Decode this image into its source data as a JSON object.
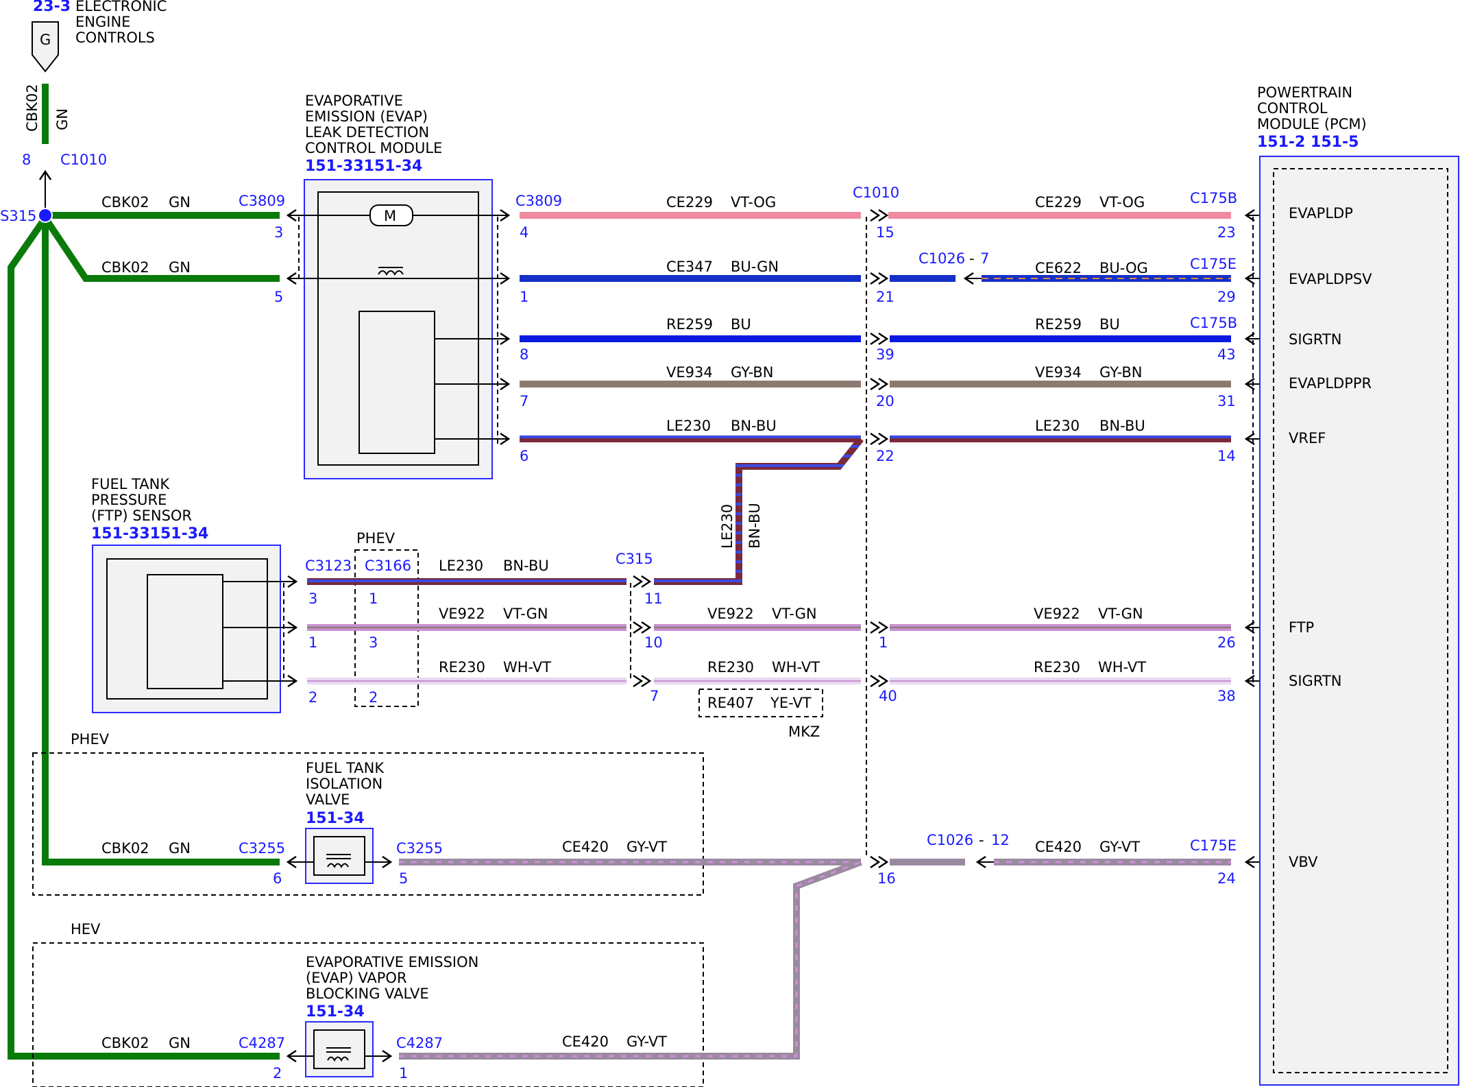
{
  "header": {
    "ref": "23-3",
    "title_lines": [
      "ELECTRONIC",
      "ENGINE",
      "CONTROLS"
    ],
    "connector_letter": "G"
  },
  "colors": {
    "GN": "#0a7a0a",
    "VT-OG": "#f08aa0",
    "BU-GN": "#1530c8",
    "BU-OG": "#1530c8",
    "BU": "#0a1ae0",
    "GY-BN": "#8a7a70",
    "BN-BU": "#7a2a3a",
    "VT-GN": "#c890d0",
    "WH-VT": "#e8d8f0",
    "GY-VT": "#9a8aa0",
    "ink": "#000000",
    "ref_blue": "#1a1aff"
  },
  "components": {
    "leak_module": {
      "lines": [
        "EVAPORATIVE",
        "EMISSION (EVAP)",
        "LEAK DETECTION",
        "CONTROL MODULE"
      ],
      "ref": "151-33151-34"
    },
    "ftp_sensor": {
      "lines": [
        "FUEL TANK",
        "PRESSURE",
        "(FTP) SENSOR"
      ],
      "ref": "151-33151-34"
    },
    "isolation_valve": {
      "lines": [
        "FUEL TANK",
        "ISOLATION",
        "VALVE"
      ],
      "ref": "151-34"
    },
    "blocking_valve": {
      "lines": [
        "EVAPORATIVE EMISSION",
        "(EVAP) VAPOR",
        "BLOCKING VALVE"
      ],
      "ref": "151-34"
    },
    "pcm": {
      "lines": [
        "POWERTRAIN",
        "CONTROL",
        "MODULE (PCM)"
      ],
      "ref": "151-2 151-5",
      "pins": [
        "EVAPLDP",
        "EVAPLDPSV",
        "SIGRTN",
        "EVAPLDPPR",
        "VREF",
        "FTP",
        "SIGRTN",
        "VBV"
      ]
    }
  },
  "splice": "S315",
  "vertical": {
    "circuit": "CBK02",
    "color": "GN",
    "pin": "8",
    "connector": "C1010"
  },
  "regions": {
    "phev_inline": "PHEV",
    "phev_box": "PHEV",
    "hev_box": "HEV",
    "mkz": "MKZ"
  },
  "ground_wires": [
    {
      "circuit": "CBK02",
      "color": "GN",
      "connector": "C3809",
      "pin": "3"
    },
    {
      "circuit": "CBK02",
      "color": "GN",
      "connector": "",
      "pin": "5"
    },
    {
      "circuit": "CBK02",
      "color": "GN",
      "connector": "C3255",
      "pin": "6"
    },
    {
      "circuit": "CBK02",
      "color": "GN",
      "connector": "C4287",
      "pin": "2"
    }
  ],
  "rows": [
    {
      "left_conn": "C3809",
      "left_pin": "4",
      "circuit": "CE229",
      "color": "VT-OG",
      "mid_conn": "C1010",
      "mid_pin": "15",
      "right_circuit": "CE229",
      "right_color": "VT-OG",
      "right_conn": "C175B",
      "right_pin": "23"
    },
    {
      "left_conn": "",
      "left_pin": "1",
      "circuit": "CE347",
      "color": "BU-GN",
      "mid_conn": "",
      "mid_pin": "21",
      "inline_conn": "C1026",
      "inline_pin": "7",
      "right_circuit": "CE622",
      "right_color": "BU-OG",
      "right_conn": "C175E",
      "right_pin": "29"
    },
    {
      "left_conn": "",
      "left_pin": "8",
      "circuit": "RE259",
      "color": "BU",
      "mid_conn": "",
      "mid_pin": "39",
      "right_circuit": "RE259",
      "right_color": "BU",
      "right_conn": "C175B",
      "right_pin": "43"
    },
    {
      "left_conn": "",
      "left_pin": "7",
      "circuit": "VE934",
      "color": "GY-BN",
      "mid_conn": "",
      "mid_pin": "20",
      "right_circuit": "VE934",
      "right_color": "GY-BN",
      "right_conn": "",
      "right_pin": "31"
    },
    {
      "left_conn": "",
      "left_pin": "6",
      "circuit": "LE230",
      "color": "BN-BU",
      "mid_conn": "",
      "mid_pin": "22",
      "right_circuit": "LE230",
      "right_color": "BN-BU",
      "right_conn": "",
      "right_pin": "14"
    }
  ],
  "vertical_wire": {
    "circuit": "LE230",
    "color": "BN-BU"
  },
  "ftp_rows": [
    {
      "c3123_pin": "3",
      "c3166_pin": "1",
      "circuit": "LE230",
      "color": "BN-BU",
      "c315_pin": "11"
    },
    {
      "c3123_pin": "1",
      "c3166_pin": "3",
      "circuit": "VE922",
      "color": "VT-GN",
      "c315_pin": "10",
      "mid_circuit": "VE922",
      "mid_color": "VT-GN",
      "c1010_pin": "1",
      "right_circuit": "VE922",
      "right_color": "VT-GN",
      "pcm_pin": "26"
    },
    {
      "c3123_pin": "2",
      "c3166_pin": "2",
      "circuit": "RE230",
      "color": "WH-VT",
      "c315_pin": "7",
      "mid_circuit": "RE230",
      "mid_color": "WH-VT",
      "c1010_pin": "40",
      "right_circuit": "RE230",
      "right_color": "WH-VT",
      "pcm_pin": "38"
    }
  ],
  "ftp_connectors": {
    "c3123": "C3123",
    "c3166": "C3166",
    "c315": "C315"
  },
  "alt_wire": {
    "circuit": "RE407",
    "color": "YE-VT"
  },
  "vbv_rows": [
    {
      "left_conn": "C3255",
      "pin": "5",
      "circuit": "CE420",
      "color": "GY-VT"
    },
    {
      "left_conn": "C4287",
      "pin": "1",
      "circuit": "CE420",
      "color": "GY-VT"
    }
  ],
  "vbv_right": {
    "mid_pin": "16",
    "inline_conn": "C1026",
    "inline_pin": "12",
    "circuit": "CE420",
    "color": "GY-VT",
    "right_conn": "C175E",
    "right_pin": "24"
  }
}
